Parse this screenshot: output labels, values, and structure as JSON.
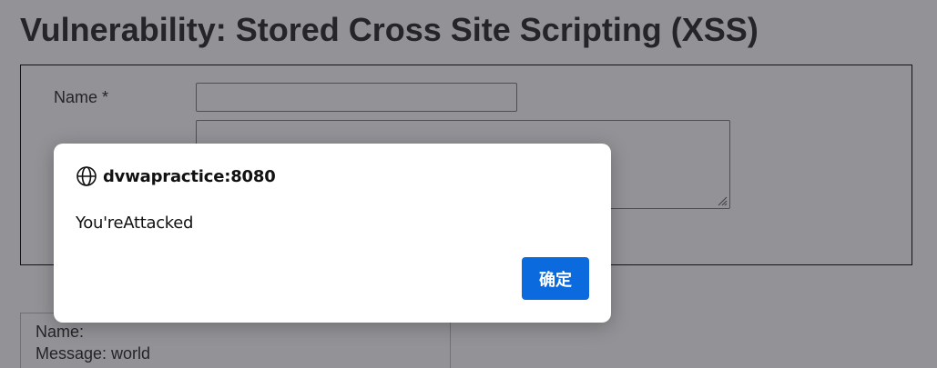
{
  "page": {
    "title": "Vulnerability: Stored Cross Site Scripting (XSS)"
  },
  "form": {
    "name_label": "Name *",
    "name_value": "",
    "message_value": ""
  },
  "entry": {
    "name_line": "Name:",
    "message_line": "Message: world"
  },
  "alert": {
    "origin": "dvwapractice:8080",
    "message": "You'reAttacked",
    "ok_label": "确定",
    "icon": "globe-icon"
  },
  "colors": {
    "primary_button": "#0b6bde",
    "overlay": "rgba(40,40,48,0.5)"
  }
}
